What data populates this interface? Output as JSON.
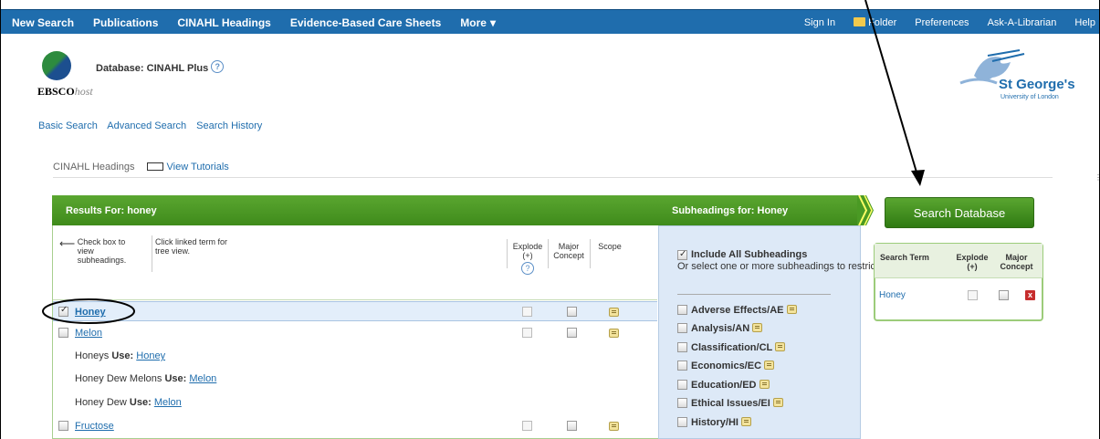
{
  "topnav": {
    "left": [
      "New Search",
      "Publications",
      "CINAHL Headings",
      "Evidence-Based Care Sheets",
      "More"
    ],
    "right": [
      "Sign In",
      "Folder",
      "Preferences",
      "Ask-A-Librarian",
      "Help"
    ]
  },
  "header": {
    "logo_text_bold": "EBSCO",
    "logo_text_italic": "host",
    "database_label": "Database: CINAHL Plus",
    "institution_name": "St George's",
    "institution_sub": "University of London"
  },
  "subnav": [
    "Basic Search",
    "Advanced Search",
    "Search History"
  ],
  "breadcrumb": {
    "current": "CINAHL Headings",
    "tutorials": "View Tutorials"
  },
  "results": {
    "header": "Results For: honey",
    "instruction_left": "Check box to view subheadings.",
    "instruction_right": "Click linked term for tree view.",
    "col_explode": "Explode (+)",
    "col_major": "Major Concept",
    "col_scope": "Scope",
    "rows": [
      {
        "term": "Honey"
      },
      {
        "term": "Melon"
      },
      {
        "use_text": "Honeys",
        "use_label": "Use:",
        "use_link": "Honey"
      },
      {
        "use_text": "Honey Dew Melons",
        "use_label": "Use:",
        "use_link": "Melon"
      },
      {
        "use_text": "Honey Dew",
        "use_label": "Use:",
        "use_link": "Melon"
      },
      {
        "term": "Fructose"
      }
    ]
  },
  "subheadings": {
    "header": "Subheadings for: Honey",
    "include_all": "Include All Subheadings",
    "include_help": "Or select one or more subheadings to restrict your search",
    "items": [
      "Adverse Effects/AE",
      "Analysis/AN",
      "Classification/CL",
      "Economics/EC",
      "Education/ED",
      "Ethical Issues/EI",
      "History/HI"
    ]
  },
  "search_panel": {
    "button": "Search Database",
    "col_term": "Search Term",
    "col_explode": "Explode (+)",
    "col_major": "Major Concept",
    "term": "Honey",
    "remove_icon": "x"
  },
  "colors": {
    "nav": "#1f6dad",
    "green": "#4a9a24",
    "link": "#1f6dad",
    "subpanel": "#dde9f7"
  }
}
